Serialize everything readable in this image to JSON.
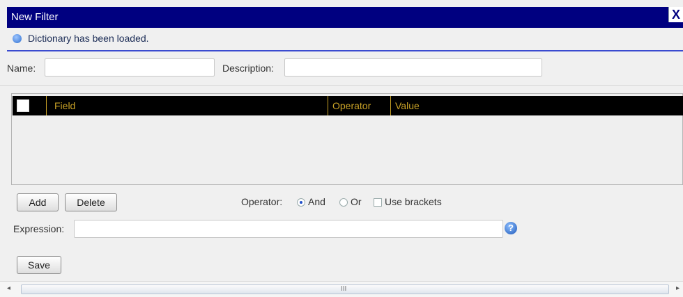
{
  "window": {
    "title": "New Filter",
    "close_glyph": "X"
  },
  "info": {
    "message": "Dictionary has been loaded.",
    "icon": "info-icon"
  },
  "form": {
    "name_label": "Name:",
    "name_value": "",
    "description_label": "Description:",
    "description_value": ""
  },
  "grid": {
    "columns": [
      "Field",
      "Operator",
      "Value"
    ],
    "rows": []
  },
  "buttons": {
    "add": "Add",
    "delete": "Delete",
    "save": "Save"
  },
  "operator": {
    "label": "Operator:",
    "options": [
      {
        "label": "And",
        "selected": true
      },
      {
        "label": "Or",
        "selected": false
      }
    ],
    "use_brackets_label": "Use brackets",
    "use_brackets_checked": false
  },
  "expression": {
    "label": "Expression:",
    "value": "",
    "help_glyph": "?"
  },
  "scrollbar": {
    "grip": "III",
    "left_arrow": "◂",
    "right_arrow": "▸"
  },
  "colors": {
    "titlebar": "#000080",
    "grid_header_bg": "#000000",
    "grid_header_text": "#c9a227",
    "rule": "#3a4bd0"
  }
}
